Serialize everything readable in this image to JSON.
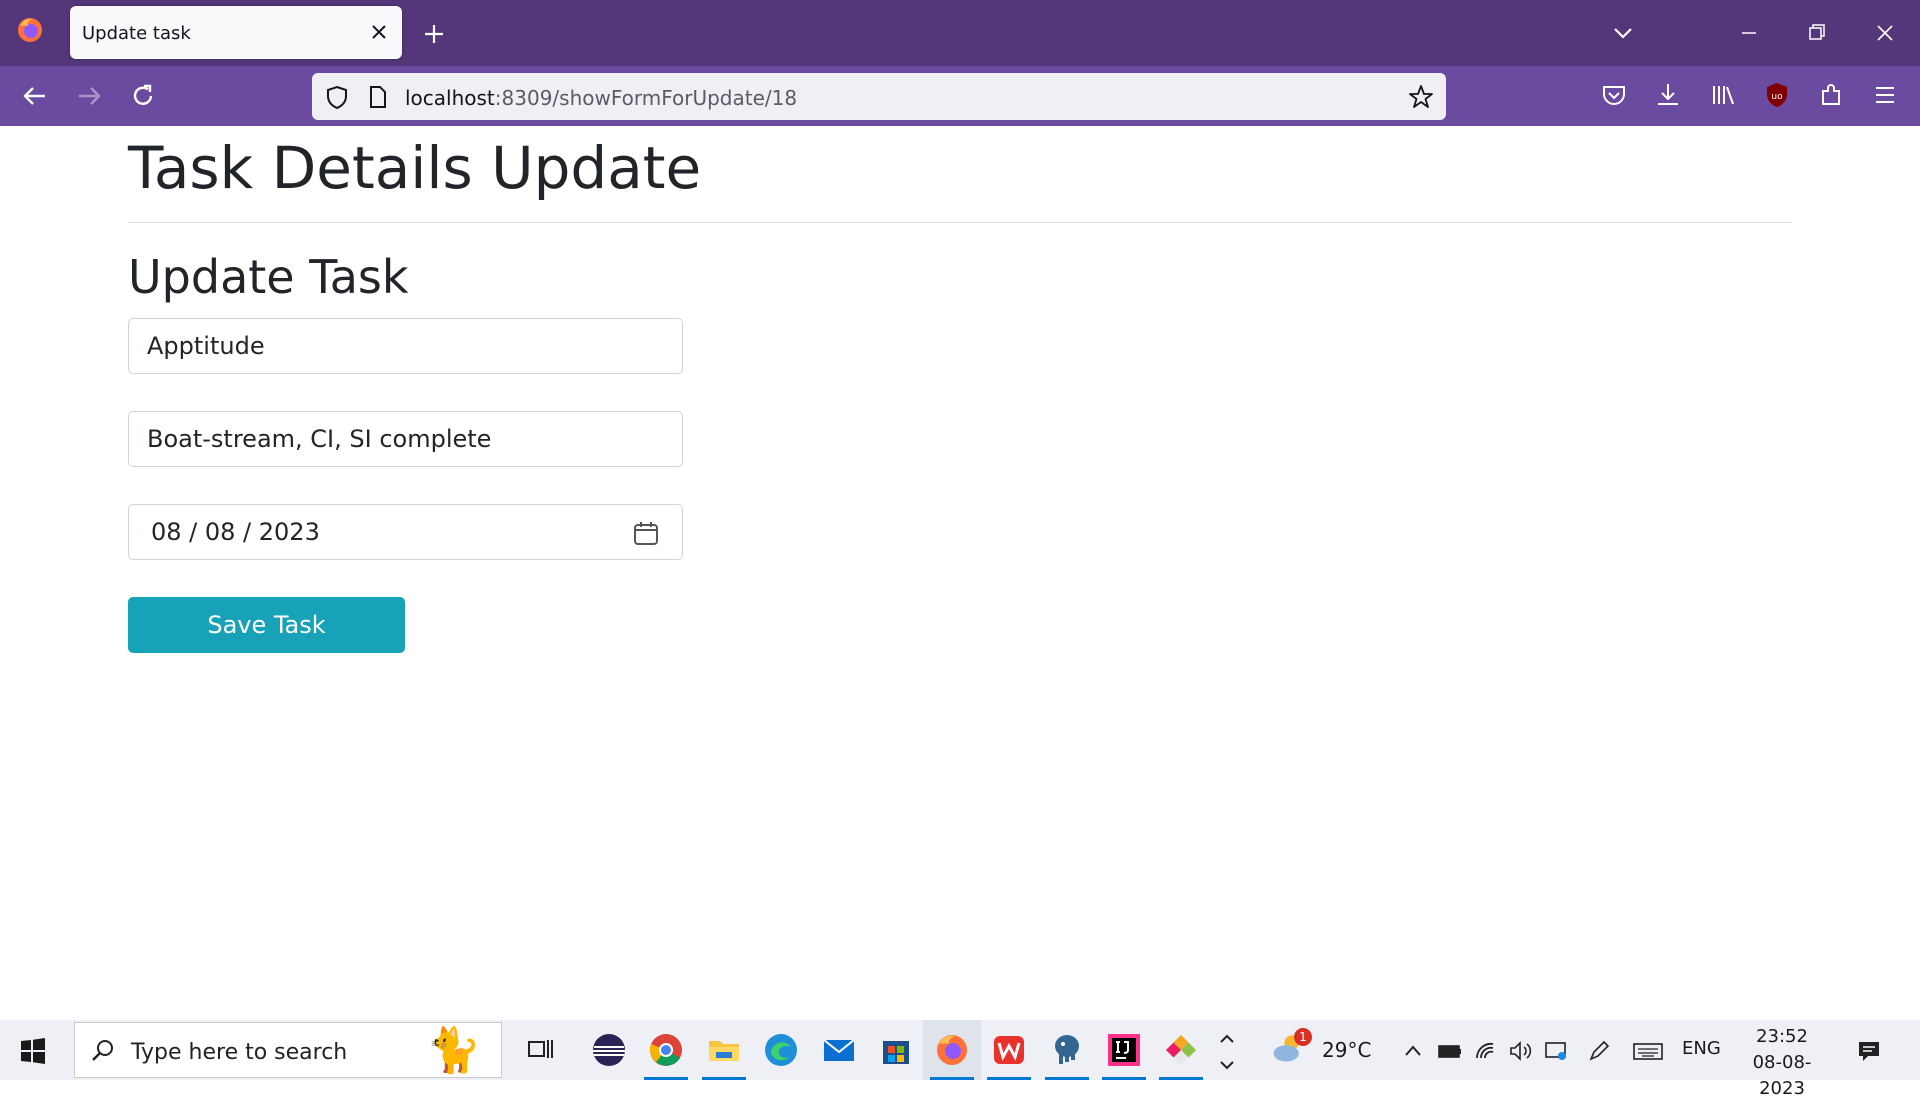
{
  "browser": {
    "tab_title": "Update task",
    "url_host": "localhost",
    "url_rest": ":8309/showFormForUpdate/18"
  },
  "page": {
    "title": "Task Details Update",
    "form_heading": "Update Task",
    "task_name_value": "Apptitude",
    "task_description_value": "Boat-stream, CI, SI complete",
    "task_date_value": "08 / 08 / 2023",
    "save_label": "Save Task"
  },
  "taskbar": {
    "search_placeholder": "Type here to search",
    "weather_temp": "29°C",
    "weather_badge": "1",
    "language": "ENG",
    "time": "23:52",
    "date": "08-08-2023"
  },
  "colors": {
    "tabbar": "#54377a",
    "navbar": "#6b4b9f",
    "save_button": "#17a2b8"
  }
}
